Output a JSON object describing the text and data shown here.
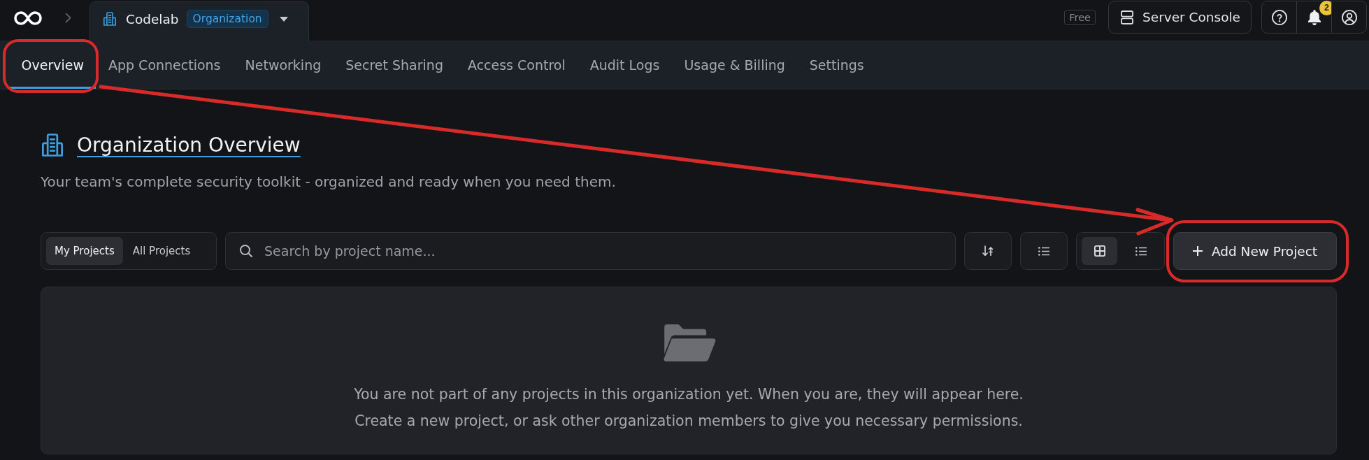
{
  "topbar": {
    "org_switcher": {
      "name": "Codelab",
      "type_badge": "Organization"
    },
    "plan_badge": "Free",
    "server_console_button": "Server Console",
    "notification_count": "2"
  },
  "tabs": [
    {
      "label": "Overview",
      "selected": true,
      "circled": true
    },
    {
      "label": "App Connections",
      "selected": false,
      "circled": false
    },
    {
      "label": "Networking",
      "selected": false,
      "circled": false
    },
    {
      "label": "Secret Sharing",
      "selected": false,
      "circled": false
    },
    {
      "label": "Access Control",
      "selected": false,
      "circled": false
    },
    {
      "label": "Audit Logs",
      "selected": false,
      "circled": false
    },
    {
      "label": "Usage & Billing",
      "selected": false,
      "circled": false
    },
    {
      "label": "Settings",
      "selected": false,
      "circled": false
    }
  ],
  "header": {
    "title": "Organization Overview",
    "subtitle": "Your team's complete security toolkit - organized and ready when you need them."
  },
  "toolbar": {
    "project_filters": [
      {
        "label": "My Projects",
        "selected": true
      },
      {
        "label": "All Projects",
        "selected": false
      }
    ],
    "search": {
      "placeholder": "Search by project name..."
    },
    "view_modes": [
      {
        "kind": "grid",
        "selected": true
      },
      {
        "kind": "list",
        "selected": false
      }
    ],
    "add_button": {
      "label": "Add New Project",
      "circled": true
    }
  },
  "empty_state": {
    "message_lines": [
      "You are not part of any projects in this organization yet. When you are, they will appear here.",
      "Create a new project, or ask other organization members to give you necessary permissions."
    ]
  },
  "annotation_arrow": true
}
